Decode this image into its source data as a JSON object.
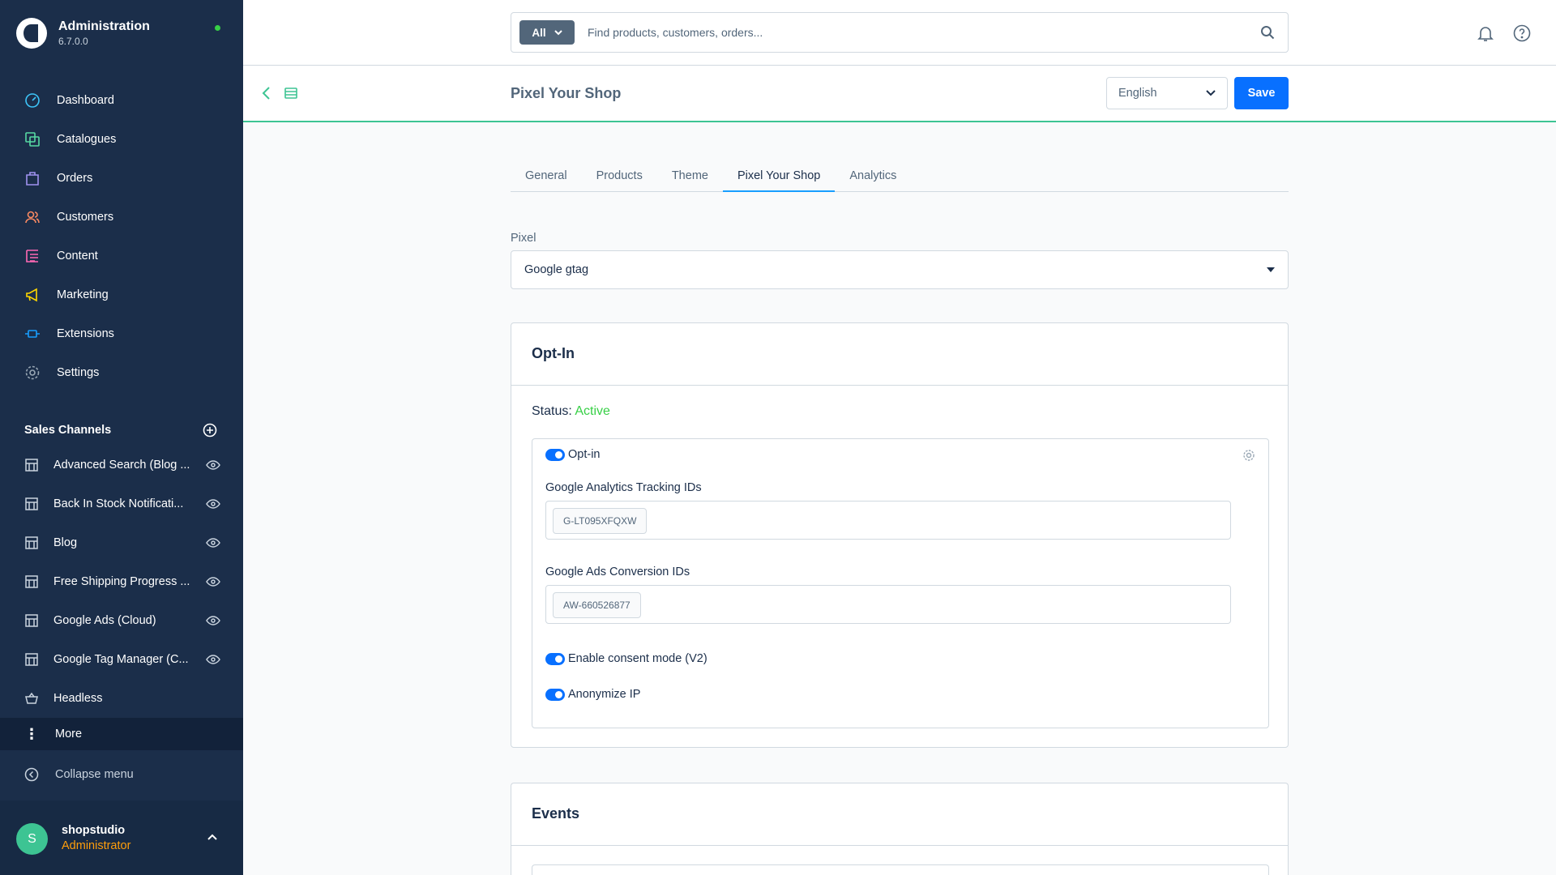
{
  "app": {
    "title": "Administration",
    "version": "6.7.0.0"
  },
  "nav": [
    {
      "label": "Dashboard",
      "icon": "dashboard-icon",
      "color": "#3dc4f8"
    },
    {
      "label": "Catalogues",
      "icon": "catalogue-icon",
      "color": "#57d9a3"
    },
    {
      "label": "Orders",
      "icon": "orders-icon",
      "color": "#a092f0"
    },
    {
      "label": "Customers",
      "icon": "customers-icon",
      "color": "#f88962"
    },
    {
      "label": "Content",
      "icon": "content-icon",
      "color": "#ff68b4"
    },
    {
      "label": "Marketing",
      "icon": "marketing-icon",
      "color": "#ffd700"
    },
    {
      "label": "Extensions",
      "icon": "extensions-icon",
      "color": "#189eff"
    },
    {
      "label": "Settings",
      "icon": "settings-icon",
      "color": "#9aa8b5"
    }
  ],
  "sales_channels": {
    "title": "Sales Channels",
    "items": [
      "Advanced Search (Blog ...",
      "Back In Stock Notificati...",
      "Blog",
      "Free Shipping Progress ...",
      "Google Ads (Cloud)",
      "Google Tag Manager (C...",
      "Headless"
    ]
  },
  "sidebar_footer": {
    "more": "More",
    "collapse": "Collapse menu"
  },
  "user": {
    "initial": "S",
    "name": "shopstudio",
    "role": "Administrator"
  },
  "search": {
    "scope": "All",
    "placeholder": "Find products, customers, orders..."
  },
  "smartbar": {
    "title": "Pixel Your Shop",
    "language": "English",
    "save": "Save"
  },
  "tabs": [
    {
      "label": "General",
      "active": false
    },
    {
      "label": "Products",
      "active": false
    },
    {
      "label": "Theme",
      "active": false
    },
    {
      "label": "Pixel Your Shop",
      "active": true
    },
    {
      "label": "Analytics",
      "active": false
    }
  ],
  "pixel": {
    "label": "Pixel",
    "value": "Google gtag"
  },
  "optin_card": {
    "title": "Opt-In",
    "status_label": "Status:",
    "status_value": "Active",
    "optin_label": "Opt-in",
    "ga_label": "Google Analytics Tracking IDs",
    "ga_tag": "G-LT095XFQXW",
    "ads_label": "Google Ads Conversion IDs",
    "ads_tag": "AW-660526877",
    "consent_label": "Enable consent mode (V2)",
    "anonymize_label": "Anonymize IP"
  },
  "events_card": {
    "title": "Events"
  },
  "colors": {
    "sidebar": "#1b2e4a",
    "accent": "#0870ff",
    "success": "#37d046",
    "brand_line": "#3dc493"
  }
}
